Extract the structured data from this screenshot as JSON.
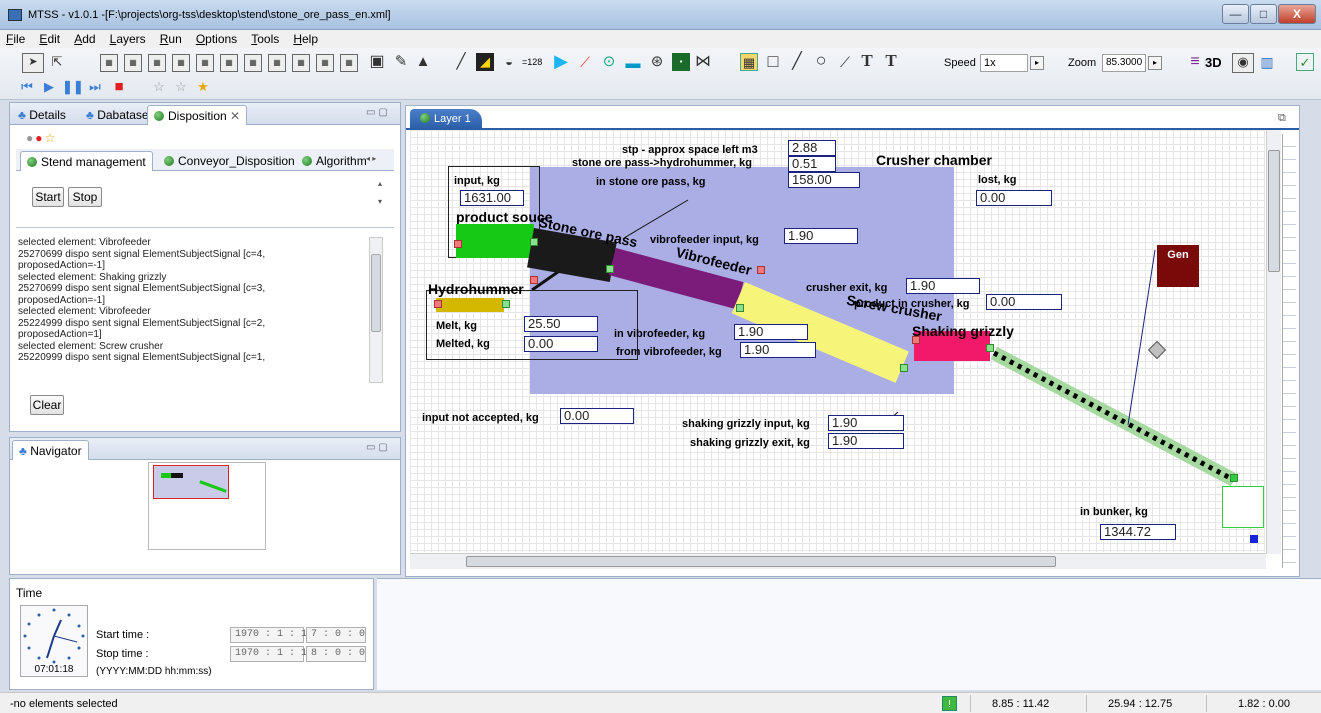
{
  "window": {
    "title": "MTSS - v1.0.1  -[F:\\projects\\org-tss\\desktop\\stend\\stone_ore_pass_en.xml]",
    "minimize": "—",
    "maximize": "□",
    "close": "X"
  },
  "menu": [
    "File",
    "Edit",
    "Add",
    "Layers",
    "Run",
    "Options",
    "Tools",
    "Help"
  ],
  "toolbar": {
    "counter_label": "=128",
    "speed_label": "Speed",
    "speed_value": "1x",
    "zoom_label": "Zoom",
    "zoom_value": "85.3000",
    "mode_3d": "3D",
    "text_tool_1": "T",
    "text_tool_2": "T"
  },
  "left_panel": {
    "tabs": [
      "Details",
      "Dabatase",
      "Disposition"
    ],
    "inner_tabs": [
      "Stend management",
      "Conveyor_Disposition",
      "Algorithm"
    ],
    "start_button": "Start",
    "stop_button": "Stop",
    "clear_button": "Clear",
    "log_lines": [
      "selected element: Vibrofeeder",
      "25270699 dispo sent signal ElementSubjectSignal [c=4,",
      "proposedAction=-1]",
      "selected element: Shaking grizzly",
      "25270699 dispo sent signal ElementSubjectSignal [c=3,",
      "proposedAction=-1]",
      "selected element: Vibrofeeder",
      "25224999 dispo sent signal ElementSubjectSignal [c=2,",
      "proposedAction=1]",
      "selected element: Screw crusher",
      "25220999 dispo sent signal ElementSubjectSignal [c=1,"
    ]
  },
  "navigator": {
    "title": "Navigator"
  },
  "editor": {
    "tab_label": "Layer 1",
    "labels": {
      "stp": "stp - approx space left m3",
      "stone_to_hydro": "stone ore pass->hydrohummer, kg",
      "in_stone_ore": "in stone ore pass, kg",
      "crusher_chamber": "Crusher chamber",
      "input": "input, kg",
      "lost": "lost, kg",
      "product_source": "product souce",
      "stone_ore_pass": "Stone ore pass",
      "vibro_input": "vibrofeeder input, kg",
      "vibrofeeder": "Vibrofeeder",
      "crusher_exit": "crusher exit, kg",
      "product_in_crusher": "product in crusher, kg",
      "hydrohummer": "Hydrohummer",
      "screw_crusher": "Screw crusher",
      "shaking_grizzly": "Shaking grizzly",
      "melt": "Melt, kg",
      "melted": "Melted, kg",
      "in_vibro": "in vibrofeeder, kg",
      "from_vibro": "from vibrofeeder, kg",
      "not_accepted": "input not accepted, kg",
      "sg_input": "shaking grizzly input, kg",
      "sg_exit": "shaking grizzly exit, kg",
      "in_bunker": "in bunker, kg",
      "gen": "Gen"
    },
    "values": {
      "stp": "2.88",
      "stone_to_hydro": "0.51",
      "in_stone_ore": "158.00",
      "input": "1631.00",
      "lost": "0.00",
      "vibro_input": "1.90",
      "crusher_exit": "1.90",
      "product_in_crusher": "0.00",
      "melt": "25.50",
      "melted": "0.00",
      "in_vibro": "1.90",
      "from_vibro": "1.90",
      "not_accepted": "0.00",
      "sg_input": "1.90",
      "sg_exit": "1.90",
      "in_bunker": "1344.72"
    }
  },
  "time_panel": {
    "title": "Time",
    "start_label": "Start time :",
    "stop_label": "Stop time :",
    "format_hint": "(YYYY:MM:DD hh:mm:ss)",
    "start_date": "1970 :  1 :  1",
    "start_time": "7 :  0 :  0",
    "stop_date": "1970 :  1 :  1",
    "stop_time": "8 :  0 :  0",
    "clock_text": "07:01:18"
  },
  "status": {
    "message": "-no elements selected",
    "coord1": "8.85 : 11.42",
    "coord2": "25.94 : 12.75",
    "coord3": "1.82 : 0.00"
  },
  "colors": {
    "product_source": "#15c915",
    "stone_ore_pass": "#1a1a1a",
    "vibrofeeder": "#7b1c7b",
    "screw_crusher": "#f6f57a",
    "shaking_grizzly": "#f2196a",
    "hydrohummer": "#d4b800",
    "crusher_chamber_bg": "#abaee5",
    "gen": "#7a0a0a",
    "conveyor": "#a6d9a0"
  }
}
